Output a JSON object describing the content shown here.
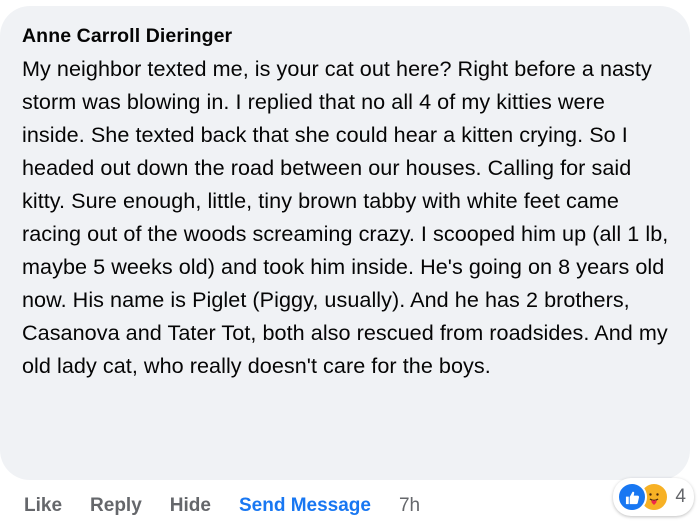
{
  "comment": {
    "author": "Anne Carroll Dieringer",
    "text": "My neighbor texted me, is your cat out here? Right before a nasty storm was blowing in. I replied that no all 4 of my kitties were inside. She texted back that she could hear a kitten crying. So I headed out down the road between our houses. Calling for said kitty. Sure enough, little, tiny brown tabby with white feet came racing out of the woods screaming crazy. I scooped him up (all 1 lb, maybe 5 weeks old) and took him inside. He's going on 8 years old now. His name is Piglet (Piggy, usually). And he has 2 brothers, Casanova and Tater Tot, both also rescued from roadsides. And my old lady cat, who really doesn't care for the boys."
  },
  "actions": {
    "like": "Like",
    "reply": "Reply",
    "hide": "Hide",
    "send_message": "Send Message",
    "timestamp": "7h"
  },
  "reactions": {
    "icons": [
      "like-icon",
      "care-icon"
    ],
    "count": "4"
  },
  "colors": {
    "bubble": "#f0f2f5",
    "text": "#050505",
    "muted": "#65676b",
    "accent": "#1877f2"
  }
}
